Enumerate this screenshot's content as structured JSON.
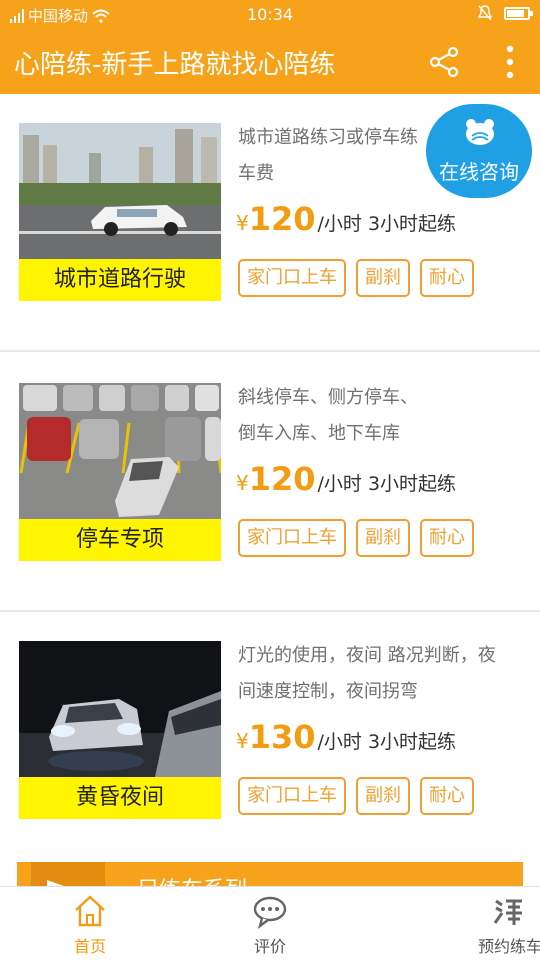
{
  "status_bar": {
    "carrier": "中国移动",
    "time": "10:34",
    "battery_level": 0.85
  },
  "app_bar": {
    "title": "心陪练-新手上路就找心陪练"
  },
  "consult": {
    "label": "在线咨询"
  },
  "courses": [
    {
      "name": "城市道路行驶",
      "desc_line1": "城市道路练习或停车练",
      "desc_line2": "车费",
      "yen": "¥",
      "price": "120",
      "unit": "/小时 3小时起练",
      "tags": [
        "家门口上车",
        "副刹",
        "耐心"
      ]
    },
    {
      "name": "停车专项",
      "desc_line1": "斜线停车、侧方停车、",
      "desc_line2": "倒车入库、地下车库",
      "yen": "¥",
      "price": "120",
      "unit": "/小时 3小时起练",
      "tags": [
        "家门口上车",
        "副刹",
        "耐心"
      ]
    },
    {
      "name": "黄昏夜间",
      "desc_line1": "灯光的使用，夜间 路况判断，夜",
      "desc_line2": "间速度控制，夜间拐弯",
      "yen": "¥",
      "price": "130",
      "unit": "/小时 3小时起练",
      "tags": [
        "家门口上车",
        "副刹",
        "耐心"
      ]
    }
  ],
  "banner": {
    "text": "另练车系列"
  },
  "nav": {
    "items": [
      {
        "label": "首页",
        "icon": "home-icon",
        "active": true
      },
      {
        "label": "评价",
        "icon": "chat-bubble-icon",
        "active": false
      },
      {
        "label": "预约练车",
        "icon": "taobao-icon",
        "active": false
      }
    ]
  },
  "colors": {
    "brand": "#f7a21b",
    "price": "#f39c12",
    "consult": "#1fa0e5",
    "caption": "#fff500"
  }
}
